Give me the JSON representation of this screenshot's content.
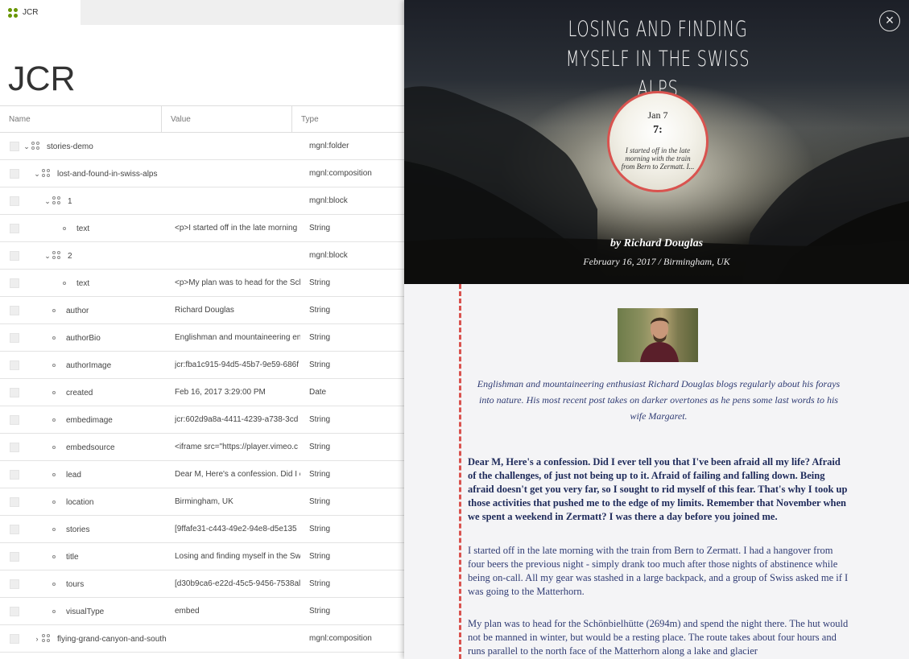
{
  "tab": {
    "label": "JCR"
  },
  "app_title": "JCR",
  "grid": {
    "headers": {
      "name": "Name",
      "value": "Value",
      "type": "Type"
    },
    "rows": [
      {
        "name": "stories-demo",
        "value": "",
        "type": "mgnl:folder",
        "kind": "node",
        "toggle": "v"
      },
      {
        "name": "lost-and-found-in-swiss-alps",
        "value": "",
        "type": "mgnl:composition",
        "kind": "node",
        "toggle": "v"
      },
      {
        "name": "1",
        "value": "",
        "type": "mgnl:block",
        "kind": "node",
        "toggle": "v"
      },
      {
        "name": "text",
        "value": "<p>I started off in the late morning",
        "type": "String",
        "kind": "prop"
      },
      {
        "name": "2",
        "value": "",
        "type": "mgnl:block",
        "kind": "node",
        "toggle": "v"
      },
      {
        "name": "text",
        "value": "<p>My plan was to head for the Sch",
        "type": "String",
        "kind": "prop"
      },
      {
        "name": "author",
        "value": "Richard Douglas",
        "type": "String",
        "kind": "prop"
      },
      {
        "name": "authorBio",
        "value": "Englishman and mountaineering en",
        "type": "String",
        "kind": "prop"
      },
      {
        "name": "authorImage",
        "value": "jcr:fba1c915-94d5-45b7-9e59-686f",
        "type": "String",
        "kind": "prop"
      },
      {
        "name": "created",
        "value": "Feb 16, 2017 3:29:00 PM",
        "type": "Date",
        "kind": "prop"
      },
      {
        "name": "embedimage",
        "value": "jcr:602d9a8a-4411-4239-a738-3cd",
        "type": "String",
        "kind": "prop"
      },
      {
        "name": "embedsource",
        "value": "<iframe src=\"https://player.vimeo.c",
        "type": "String",
        "kind": "prop"
      },
      {
        "name": "lead",
        "value": "Dear M, Here's a confession. Did I e",
        "type": "String",
        "kind": "prop"
      },
      {
        "name": "location",
        "value": "Birmingham, UK",
        "type": "String",
        "kind": "prop"
      },
      {
        "name": "stories",
        "value": "[9ffafe31-c443-49e2-94e8-d5e135",
        "type": "String",
        "kind": "prop"
      },
      {
        "name": "title",
        "value": "Losing and finding myself in the Sw",
        "type": "String",
        "kind": "prop"
      },
      {
        "name": "tours",
        "value": "[d30b9ca6-e22d-45c5-9456-7538al",
        "type": "String",
        "kind": "prop"
      },
      {
        "name": "visualType",
        "value": "embed",
        "type": "String",
        "kind": "prop"
      },
      {
        "name": "flying-grand-canyon-and-south",
        "value": "",
        "type": "mgnl:composition",
        "kind": "node",
        "toggle": ">"
      }
    ]
  },
  "story": {
    "title": "Losing and finding myself in the Swiss Alps",
    "close": "×",
    "badge": {
      "date": "Jan 7",
      "number": "7:",
      "excerpt": "I started off in the late morning with the train from Bern to Zermatt. I..."
    },
    "byline": "by Richard Douglas",
    "dateline": "February 16, 2017 / Birmingham, UK",
    "author_bio": "Englishman and mountaineering enthusiast Richard Douglas blogs regularly about his forays into nature. His most recent post takes on darker overtones as he pens some last words to his wife Margaret.",
    "lead": "Dear M, Here's a confession. Did I ever tell you that I've been afraid all my life? Afraid of the challenges, of just not being up to it. Afraid of failing and falling down. Being afraid doesn't get you very far, so I sought to rid myself of this fear. That's why I took up those activities that pushed me to the edge of my limits. Remember that November when we spent a weekend in Zermatt? I was there a day before you joined me.",
    "paragraphs": [
      "I started off in the late morning with the train from Bern to Zermatt. I had a hangover from four beers the previous night - simply drank too much after those nights of abstinence while being on-call. All my gear was stashed in a large backpack, and a group of Swiss asked me if I was going to the Matterhorn.",
      "My plan was to head for the Schönbielhütte (2694m) and spend the night there. The hut would not be manned in winter, but would be a resting place. The route takes about four hours and runs parallel to the north face of the Matterhorn along a lake and glacier"
    ]
  },
  "colors": {
    "accent_red": "#d9534f",
    "brand_green": "#689600",
    "story_text": "#2f3b73"
  }
}
